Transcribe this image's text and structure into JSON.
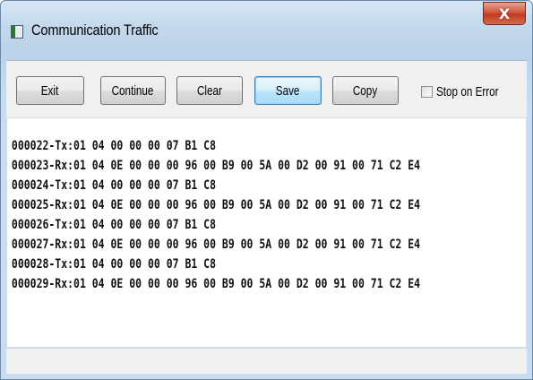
{
  "window": {
    "title": "Communication Traffic",
    "close_glyph": "X"
  },
  "toolbar": {
    "exit_label": "Exit",
    "continue_label": "Continue",
    "clear_label": "Clear",
    "save_label": "Save",
    "copy_label": "Copy",
    "stop_on_error_label": "Stop on Error",
    "stop_on_error_checked": false
  },
  "log": {
    "lines": [
      "000022-Tx:01 04 00 00 00 07 B1 C8",
      "000023-Rx:01 04 0E 00 00 00 96 00 B9 00 5A 00 D2 00 91 00 71 C2 E4",
      "000024-Tx:01 04 00 00 00 07 B1 C8",
      "000025-Rx:01 04 0E 00 00 00 96 00 B9 00 5A 00 D2 00 91 00 71 C2 E4",
      "000026-Tx:01 04 00 00 00 07 B1 C8",
      "000027-Rx:01 04 0E 00 00 00 96 00 B9 00 5A 00 D2 00 91 00 71 C2 E4",
      "000028-Tx:01 04 00 00 00 07 B1 C8",
      "000029-Rx:01 04 0E 00 00 00 96 00 B9 00 5A 00 D2 00 91 00 71 C2 E4"
    ]
  }
}
